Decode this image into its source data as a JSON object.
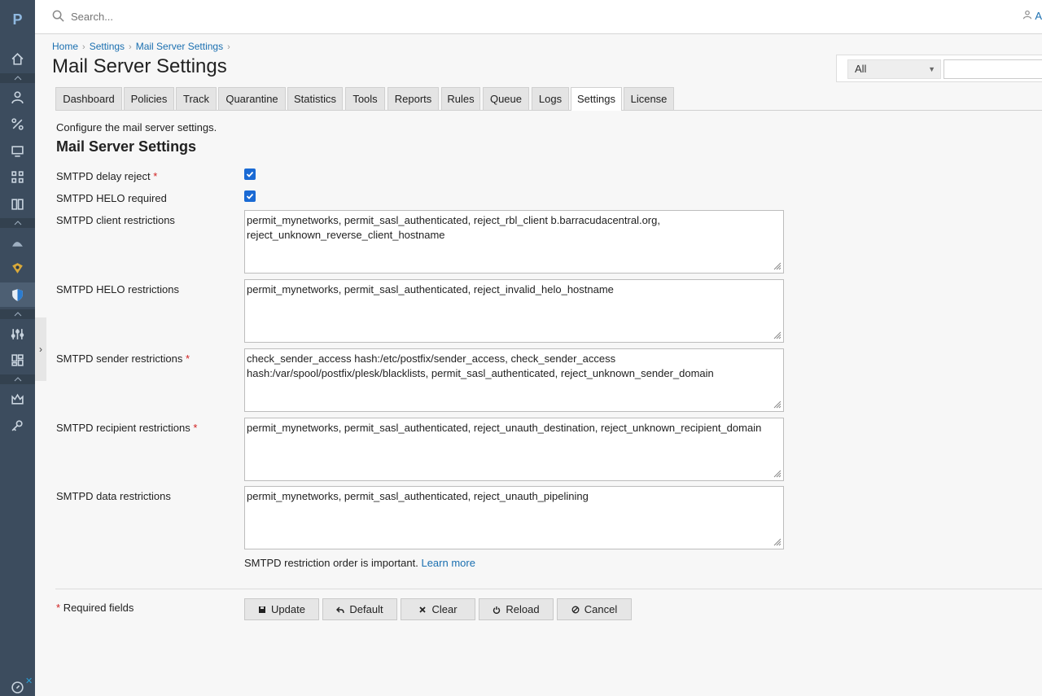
{
  "rail": {
    "logo": "P",
    "icons": [
      "home-icon",
      "user-icon",
      "percent-icon",
      "monitor-icon",
      "grid-icon",
      "book-icon",
      "shark-icon",
      "shield-badge-icon",
      "shield-icon",
      "sliders-icon",
      "dashboard-icon",
      "crown-icon",
      "key-icon",
      "compass-icon"
    ]
  },
  "topbar": {
    "search_placeholder": "Search...",
    "user_text": "A"
  },
  "breadcrumb": [
    "Home",
    "Settings",
    "Mail Server Settings"
  ],
  "page_title": "Mail Server Settings",
  "filter": {
    "selected": "All"
  },
  "tabs": [
    "Dashboard",
    "Policies",
    "Track",
    "Quarantine",
    "Statistics",
    "Tools",
    "Reports",
    "Rules",
    "Queue",
    "Logs",
    "Settings",
    "License"
  ],
  "active_tab": "Settings",
  "intro": "Configure the mail server settings.",
  "section_title": "Mail Server Settings",
  "fields": {
    "delay_reject": {
      "label": "SMTPD delay reject",
      "required": "*",
      "checked": true
    },
    "helo_required": {
      "label": "SMTPD HELO required",
      "checked": true
    },
    "client_restrictions": {
      "label": "SMTPD client restrictions",
      "value": "permit_mynetworks, permit_sasl_authenticated, reject_rbl_client b.barracudacentral.org, reject_unknown_reverse_client_hostname"
    },
    "helo_restrictions": {
      "label": "SMTPD HELO restrictions",
      "value": "permit_mynetworks, permit_sasl_authenticated, reject_invalid_helo_hostname"
    },
    "sender_restrictions": {
      "label": "SMTPD sender restrictions",
      "required": "*",
      "value": "check_sender_access hash:/etc/postfix/sender_access, check_sender_access hash:/var/spool/postfix/plesk/blacklists, permit_sasl_authenticated, reject_unknown_sender_domain"
    },
    "recipient_restrictions": {
      "label": "SMTPD recipient restrictions",
      "required": "*",
      "value": "permit_mynetworks, permit_sasl_authenticated, reject_unauth_destination, reject_unknown_recipient_domain"
    },
    "data_restrictions": {
      "label": "SMTPD data restrictions",
      "value": "permit_mynetworks, permit_sasl_authenticated, reject_unauth_pipelining"
    }
  },
  "hint": {
    "text": "SMTPD restriction order is important.",
    "link": "Learn more"
  },
  "required_note": {
    "star": "*",
    "text": "Required fields"
  },
  "buttons": {
    "update": "Update",
    "default": "Default",
    "clear": "Clear",
    "reload": "Reload",
    "cancel": "Cancel"
  },
  "colors": {
    "rail": "#3c4c5e",
    "link": "#1a6fb0",
    "required": "#d02020",
    "checkbox": "#1a6ad4"
  }
}
